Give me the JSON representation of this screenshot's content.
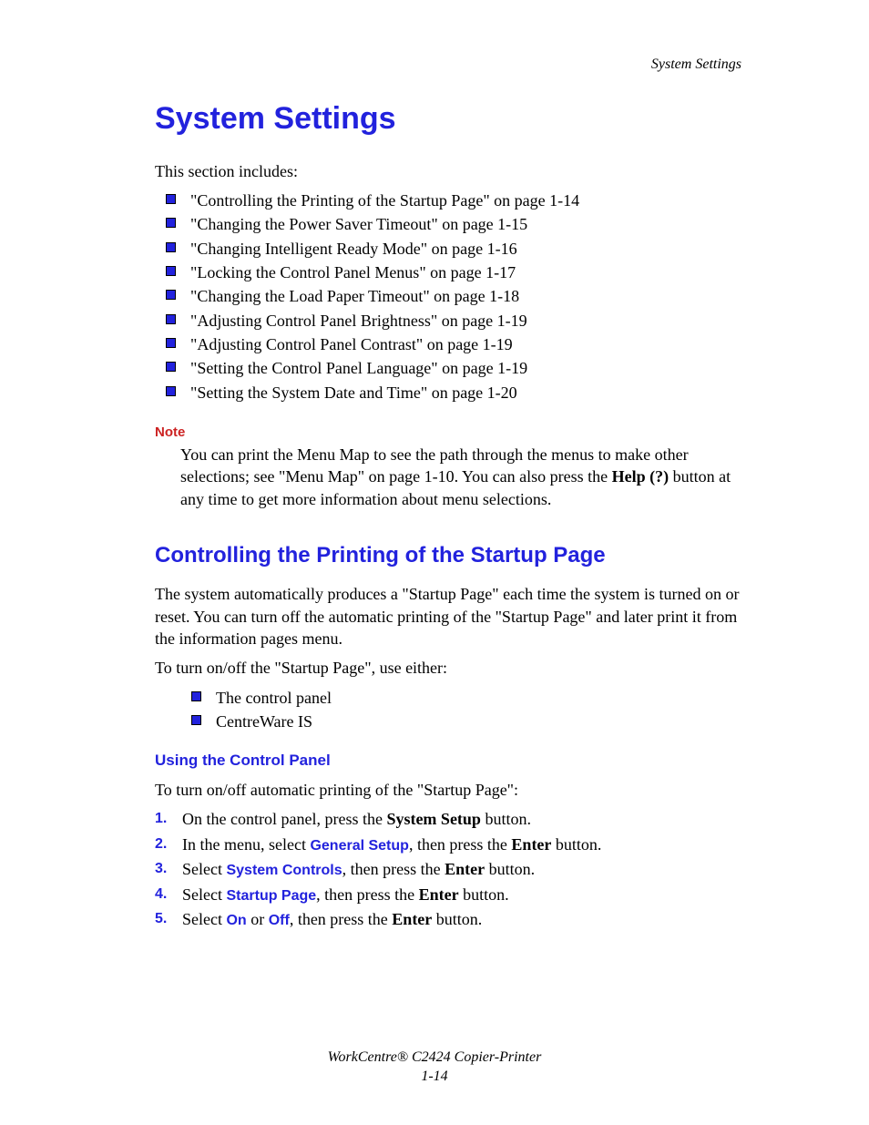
{
  "running_head": "System Settings",
  "h1": "System Settings",
  "intro": "This section includes:",
  "links": [
    "\"Controlling the Printing of the Startup Page\" on page 1-14",
    "\"Changing the Power Saver Timeout\" on page 1-15",
    "\"Changing Intelligent Ready Mode\" on page 1-16",
    "\"Locking the Control Panel Menus\" on page 1-17",
    "\"Changing the Load Paper Timeout\" on page 1-18",
    "\"Adjusting Control Panel Brightness\" on page 1-19",
    "\"Adjusting Control Panel Contrast\" on page 1-19",
    "\"Setting the Control Panel Language\" on page 1-19",
    "\"Setting the System Date and Time\" on page 1-20"
  ],
  "note_label": "Note",
  "note_body_1": "You can print the Menu Map to see the path through the menus to make other selections; see \"Menu Map\" on page 1-10. You can also press the ",
  "note_body_bold": "Help (?)",
  "note_body_2": " button at any time to get more information about menu selections.",
  "h2": "Controlling the Printing of the Startup Page",
  "para_start": "The system automatically produces a \"Startup Page\" each time the system is turned on or reset. You can turn off the automatic printing of the \"Startup Page\" and later print it from the information pages menu.",
  "para_use": "To turn on/off the \"Startup Page\", use either:",
  "use_list": [
    "The control panel",
    "CentreWare IS"
  ],
  "h3": "Using the Control Panel",
  "para_cp": "To turn on/off automatic printing of the \"Startup Page\":",
  "steps": [
    {
      "pre": "On the control panel, press the ",
      "b": "System Setup",
      "post": " button."
    },
    {
      "pre": "In the menu, select ",
      "blue": "General Setup",
      "post1": ", then press the ",
      "b": "Enter",
      "post2": " button."
    },
    {
      "pre": "Select ",
      "blue": "System Controls",
      "post1": ", then press the ",
      "b": "Enter",
      "post2": " button."
    },
    {
      "pre": "Select ",
      "blue": "Startup Page",
      "post1": ", then press the ",
      "b": "Enter",
      "post2": " button."
    },
    {
      "pre": "Select ",
      "blue": "On",
      "mid": " or ",
      "blue2": "Off",
      "post1": ", then press the ",
      "b": "Enter",
      "post2": " button."
    }
  ],
  "footer_product": "WorkCentre® C2424 Copier-Printer",
  "footer_page": "1-14"
}
